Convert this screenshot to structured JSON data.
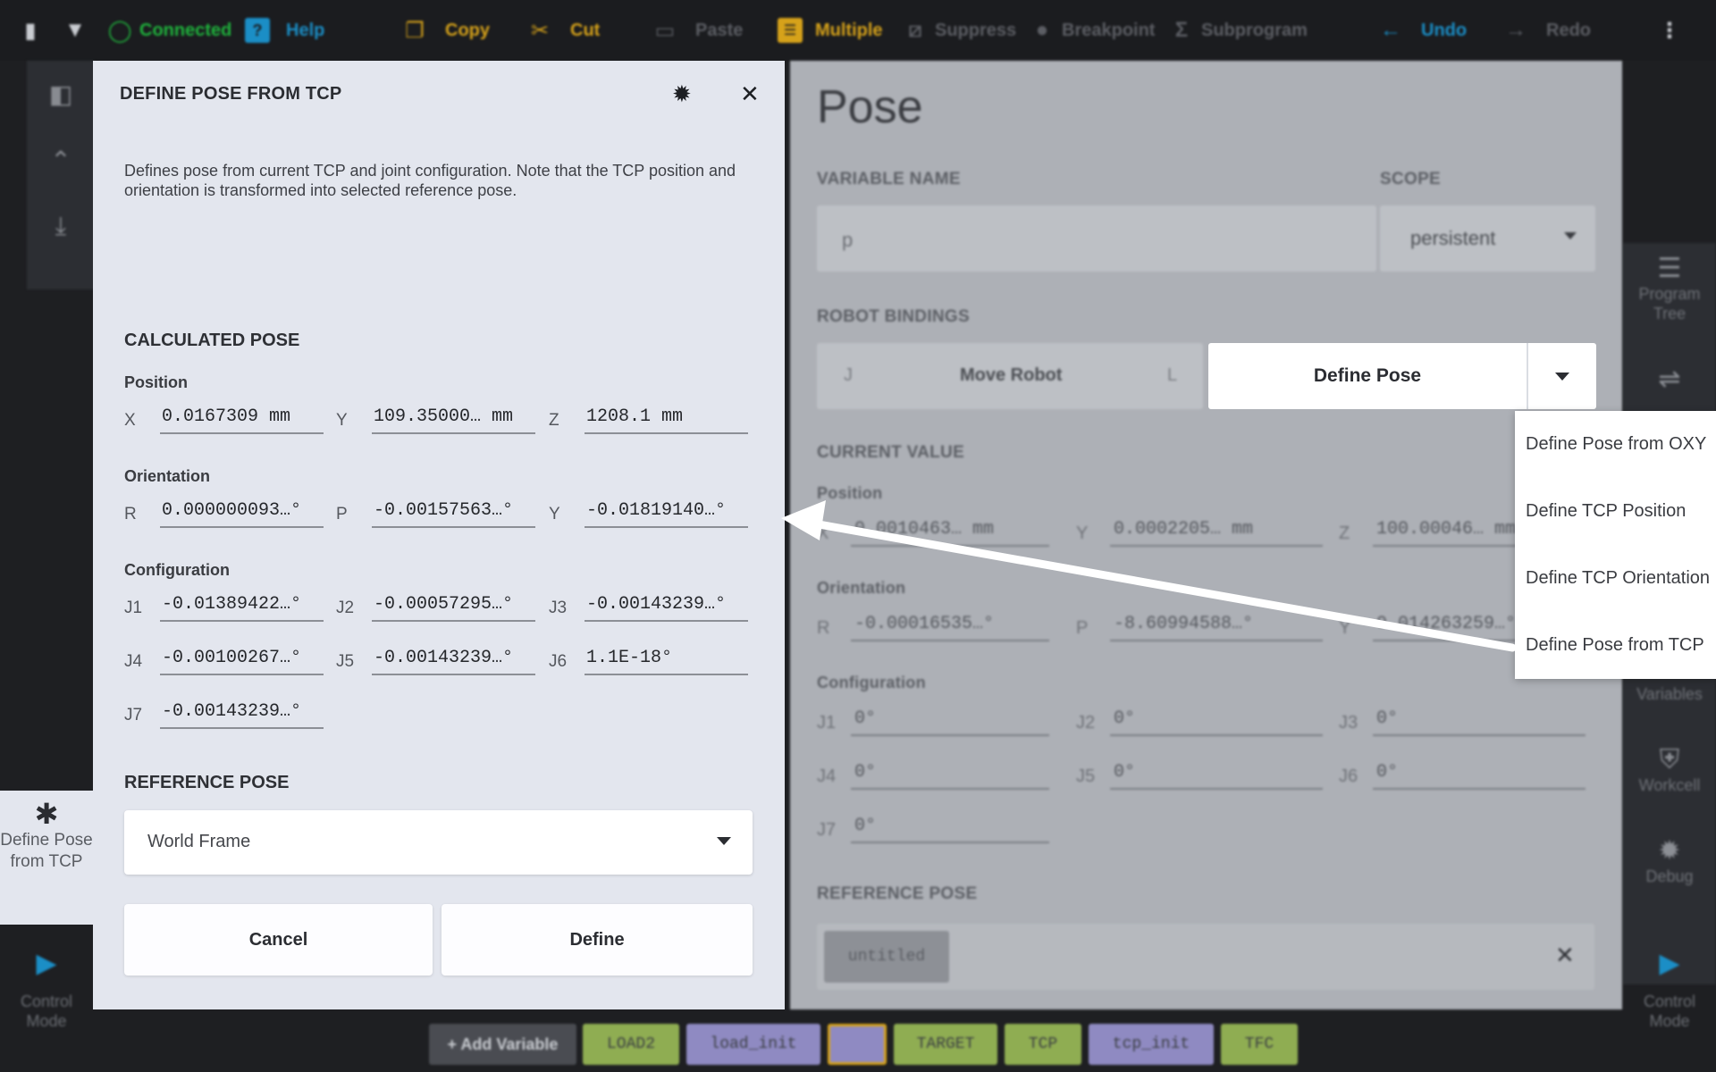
{
  "toolbar": {
    "connected": "Connected",
    "help": "Help",
    "copy": "Copy",
    "cut": "Cut",
    "paste": "Paste",
    "multiple": "Multiple",
    "suppress": "Suppress",
    "breakpoint": "Breakpoint",
    "subprogram": "Subprogram",
    "undo": "Undo",
    "redo": "Redo"
  },
  "background": {
    "title": "Pose",
    "variable_name_label": "VARIABLE NAME",
    "variable_name_value": "p",
    "scope_label": "SCOPE",
    "scope_value": "persistent",
    "robot_bindings_label": "ROBOT BINDINGS",
    "joint_label": "J",
    "move_robot": "Move Robot",
    "linear_label": "L",
    "current_value_label": "CURRENT VALUE",
    "position_label": "Position",
    "position": [
      {
        "axis": "X",
        "value": "0.0010463… mm"
      },
      {
        "axis": "Y",
        "value": "0.0002205… mm"
      },
      {
        "axis": "Z",
        "value": "100.00046… mm"
      }
    ],
    "orientation_label": "Orientation",
    "orientation": [
      {
        "axis": "R",
        "value": "-0.00016535…°"
      },
      {
        "axis": "P",
        "value": "-8.60994588…°"
      },
      {
        "axis": "Y",
        "value": "0.014263259…°"
      }
    ],
    "configuration_label": "Configuration",
    "configuration": [
      {
        "axis": "J1",
        "value": "0°"
      },
      {
        "axis": "J2",
        "value": "0°"
      },
      {
        "axis": "J3",
        "value": "0°"
      },
      {
        "axis": "J4",
        "value": "0°"
      },
      {
        "axis": "J5",
        "value": "0°"
      },
      {
        "axis": "J6",
        "value": "0°"
      },
      {
        "axis": "J7",
        "value": "0°"
      }
    ],
    "reference_pose_label": "REFERENCE POSE",
    "reference_chip": "untitled"
  },
  "right_rail": {
    "program_tree": "Program Tree",
    "variables": "Variables",
    "workcell": "Workcell",
    "debug": "Debug",
    "control_mode": "Control Mode"
  },
  "left_rail": {
    "control_mode": "Control Mode"
  },
  "side_tab": {
    "label": "Define Pose from TCP"
  },
  "dialog": {
    "title": "DEFINE POSE FROM TCP",
    "description": "Defines pose from current TCP and joint configuration. Note that the TCP position and orientation is transformed into selected reference pose.",
    "calculated_pose": "CALCULATED POSE",
    "position_label": "Position",
    "position": [
      {
        "axis": "X",
        "value": "0.0167309 mm"
      },
      {
        "axis": "Y",
        "value": "109.35000… mm"
      },
      {
        "axis": "Z",
        "value": "1208.1 mm"
      }
    ],
    "orientation_label": "Orientation",
    "orientation": [
      {
        "axis": "R",
        "value": "0.000000093…°"
      },
      {
        "axis": "P",
        "value": "-0.00157563…°"
      },
      {
        "axis": "Y",
        "value": "-0.01819140…°"
      }
    ],
    "configuration_label": "Configuration",
    "configuration": [
      {
        "axis": "J1",
        "value": "-0.01389422…°"
      },
      {
        "axis": "J2",
        "value": "-0.00057295…°"
      },
      {
        "axis": "J3",
        "value": "-0.00143239…°"
      },
      {
        "axis": "J4",
        "value": "-0.00100267…°"
      },
      {
        "axis": "J5",
        "value": "-0.00143239…°"
      },
      {
        "axis": "J6",
        "value": "1.1E-18°"
      },
      {
        "axis": "J7",
        "value": "-0.00143239…°"
      }
    ],
    "reference_pose_label": "REFERENCE POSE",
    "reference_pose_value": "World Frame",
    "cancel": "Cancel",
    "define": "Define"
  },
  "define_pose": {
    "label": "Define Pose"
  },
  "menu": {
    "items": [
      "Define Pose from OXY",
      "Define TCP Position",
      "Define TCP Orientation",
      "Define Pose from TCP"
    ]
  },
  "bottom": {
    "add_variable": "+ Add Variable",
    "chips": [
      "LOAD2",
      "load_init",
      "",
      "TARGET",
      "TCP",
      "tcp_init",
      "TFC"
    ]
  },
  "colors": {
    "accent_blue": "#1b8ec6",
    "connected_green": "#1fb33c",
    "edit_yellow": "#d6a21a",
    "chip_green": "#8fad52",
    "chip_purple": "#8f8ac2"
  }
}
